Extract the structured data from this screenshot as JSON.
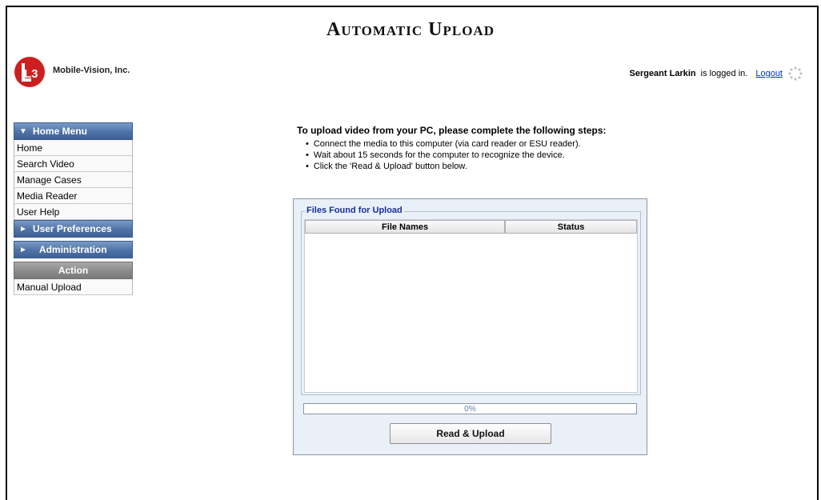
{
  "page": {
    "title": "Automatic Upload"
  },
  "brand": {
    "company": "Mobile-Vision, Inc.",
    "logo_text": "L3",
    "logo_color": "#cc1f1f"
  },
  "user": {
    "name": "Sergeant Larkin",
    "status_text": "is logged in.",
    "logout_label": "Logout"
  },
  "nav": {
    "home_menu_label": "Home Menu",
    "items": [
      "Home",
      "Search Video",
      "Manage Cases",
      "Media Reader",
      "User Help"
    ],
    "user_prefs_label": "User Preferences",
    "admin_label": "Administration",
    "action_label": "Action",
    "action_items": [
      "Manual Upload"
    ]
  },
  "instructions": {
    "heading": "To upload video from your PC, please complete the following steps:",
    "steps": [
      "Connect the media to this computer (via card reader or ESU reader).",
      "Wait about 15 seconds for the computer to recognize the device.",
      "Click the 'Read & Upload' button below."
    ]
  },
  "upload": {
    "legend": "Files Found for Upload",
    "columns": [
      "File Names",
      "Status"
    ],
    "files": [],
    "progress_label": "0%",
    "progress_fraction": 0,
    "button_label": "Read & Upload"
  },
  "icons": {
    "collapse": "triangle-down-icon",
    "expand": "triangle-right-icon",
    "busy": "spinner-icon"
  }
}
